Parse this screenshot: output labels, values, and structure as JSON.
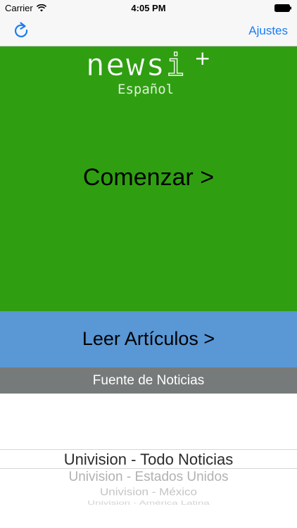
{
  "status_bar": {
    "carrier": "Carrier",
    "time": "4:05 PM",
    "wifi_icon": "wifi-icon",
    "battery_icon": "battery-icon"
  },
  "nav_bar": {
    "refresh_icon": "refresh-icon",
    "settings_label": "Ajustes",
    "accent_color": "#1a7cf5"
  },
  "logo": {
    "word_main": "news",
    "word_outline": "i",
    "plus": "+",
    "language": "Español"
  },
  "hero": {
    "start_label": "Comenzar >",
    "color": "#2f9f11"
  },
  "read": {
    "label": "Leer Artículos >",
    "color": "#5997d5"
  },
  "source_section": {
    "header": "Fuente de Noticias",
    "color": "#777a7a",
    "options": [
      "Univision - Todo Noticias",
      "Univision - Estados Unidos",
      "Univision - México",
      "Univision - América Latina"
    ]
  }
}
